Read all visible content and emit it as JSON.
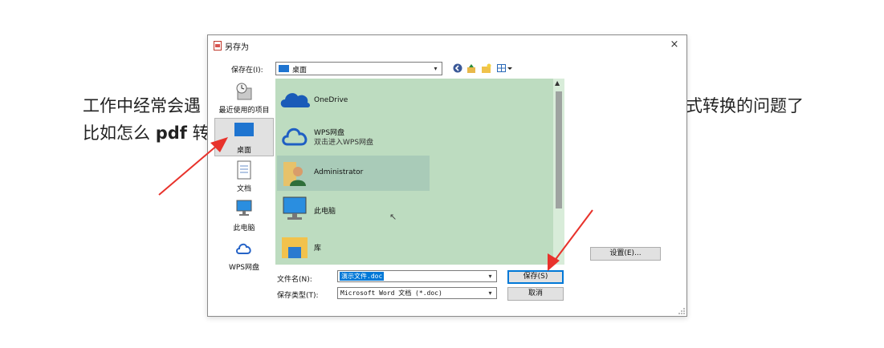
{
  "document": {
    "line1_left": "工作中经常会遇",
    "line1_right": "式转换的问题了",
    "line2_prefix": "比如怎么 ",
    "line2_bold": "pdf",
    "line2_suffix": " 转"
  },
  "dialog": {
    "title": "另存为",
    "close_glyph": "×",
    "save_in_label": "保存在(I):",
    "save_in_value": "桌面",
    "places": [
      {
        "label": "最近使用的项目",
        "icon": "recent-icon"
      },
      {
        "label": "桌面",
        "icon": "desktop-icon"
      },
      {
        "label": "文档",
        "icon": "document-icon"
      },
      {
        "label": "此电脑",
        "icon": "computer-icon"
      },
      {
        "label": "WPS网盘",
        "icon": "cloud-icon"
      }
    ],
    "files": [
      {
        "name": "OneDrive",
        "sub": "",
        "icon": "onedrive-icon"
      },
      {
        "name": "WPS网盘",
        "sub": "双击进入WPS网盘",
        "icon": "cloud-icon"
      },
      {
        "name": "Administrator",
        "sub": "",
        "icon": "user-folder-icon"
      },
      {
        "name": "此电脑",
        "sub": "",
        "icon": "computer-icon"
      },
      {
        "name": "库",
        "sub": "",
        "icon": "library-folder-icon"
      }
    ],
    "filename_label": "文件名(N):",
    "filename_value": "演示文件.doc",
    "filetype_label": "保存类型(T):",
    "filetype_value": "Microsoft Word 文档 (*.doc)",
    "save_button": "保存(S)",
    "cancel_button": "取消",
    "settings_button": "设置(E)..."
  },
  "colors": {
    "list_background": "#bddcc0",
    "selected_item": "#a9cbb8",
    "accent": "#0078d7",
    "annotation_arrow": "#e8322b"
  }
}
